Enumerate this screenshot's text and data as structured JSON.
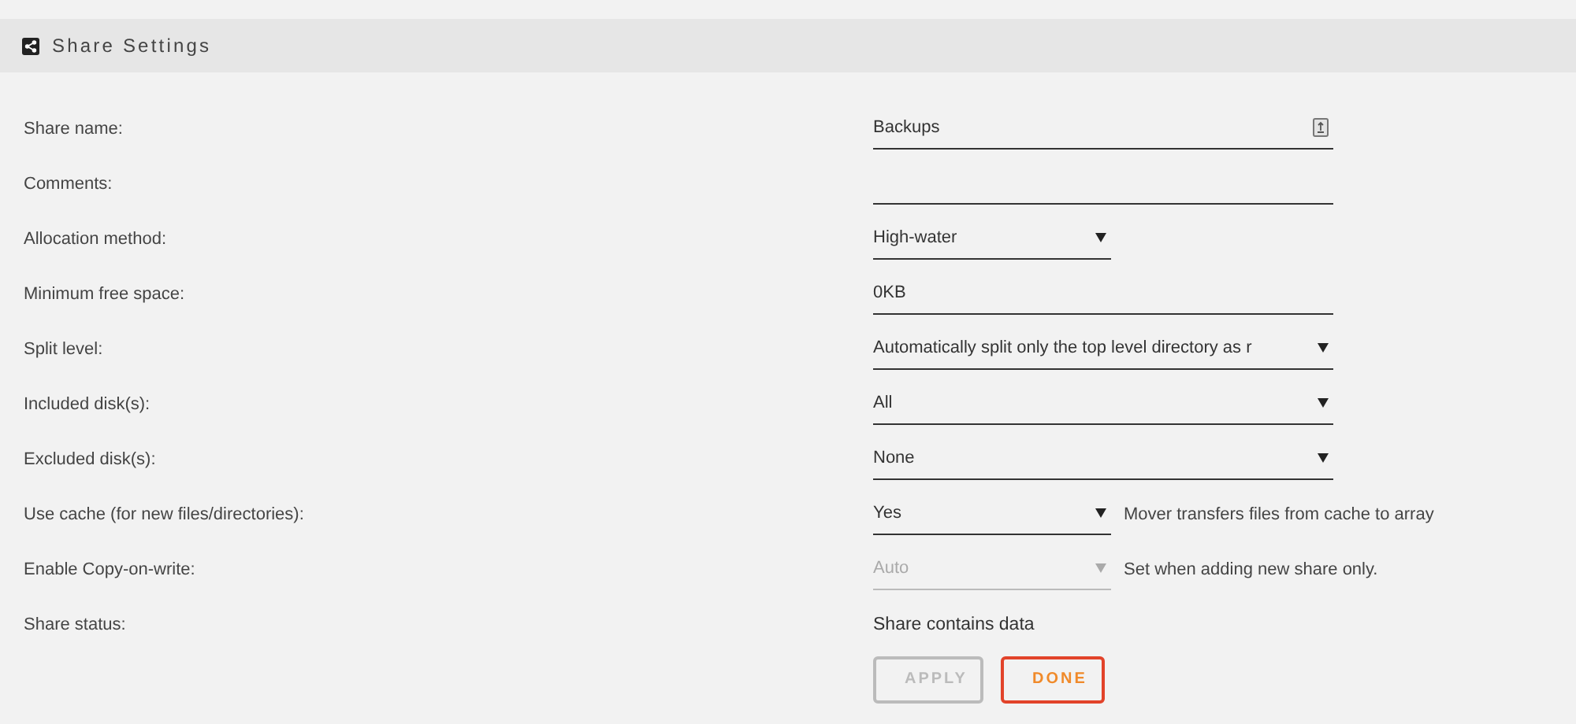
{
  "header": {
    "title": "Share Settings"
  },
  "rows": [
    {
      "label": "Share name:",
      "kind": "text",
      "value": "Backups",
      "icon": true
    },
    {
      "label": "Comments:",
      "kind": "text"
    },
    {
      "label": "Allocation method:",
      "kind": "short-select",
      "value": "High-water",
      "disabled": false
    },
    {
      "label": "Minimum free space:",
      "kind": "text",
      "value": "0KB"
    },
    {
      "label": "Split level:",
      "kind": "select",
      "value": "Automatically split only the top level directory as r"
    },
    {
      "label": "Included disk(s):",
      "kind": "select",
      "value": "All"
    },
    {
      "label": "Excluded disk(s):",
      "kind": "select",
      "value": "None"
    },
    {
      "label": "Use cache (for new files/directories):",
      "kind": "short-select",
      "value": "Yes",
      "disabled": false,
      "note": "Mover transfers files from cache to array"
    },
    {
      "label": "Enable Copy-on-write:",
      "kind": "short-select",
      "value": "Auto",
      "disabled": true,
      "note": "Set when adding new share only."
    },
    {
      "label": "Share status:",
      "kind": "status",
      "value": "Share contains data"
    }
  ],
  "buttons": [
    {
      "label": "APPLY",
      "disabled": true
    },
    {
      "label": "DONE",
      "disabled": false
    }
  ]
}
